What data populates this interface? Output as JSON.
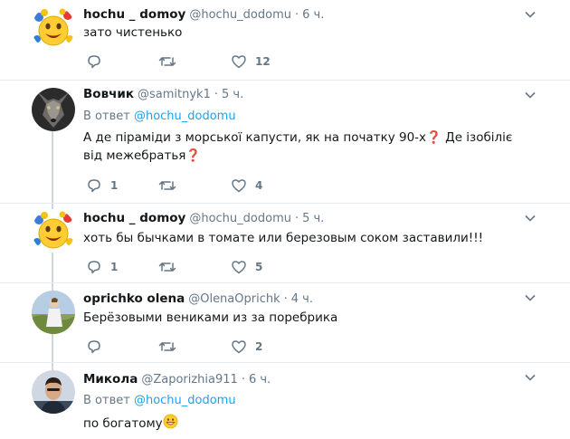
{
  "tweets": [
    {
      "name": "hochu _ domoy",
      "handle": "@hochu_dodomu",
      "time": "6 ч.",
      "reply_to": null,
      "text": "зато чистенько",
      "replies": "",
      "retweets": "",
      "likes": "12",
      "avatar": "emoji-flower-avatar"
    },
    {
      "name": "Вовчик",
      "handle": "@samitnyk1",
      "time": "5 ч.",
      "reply_to": {
        "prefix": "В ответ",
        "user": "@hochu_dodomu"
      },
      "text": "А де піраміди з морської капусти, як на початку 90-х❓ Де ізобіліє від межебратья❓",
      "replies": "1",
      "retweets": "",
      "likes": "4",
      "avatar": "wolf-avatar"
    },
    {
      "name": "hochu _ domoy",
      "handle": "@hochu_dodomu",
      "time": "5 ч.",
      "reply_to": null,
      "text": "хоть бы бычками  в томате или березовым соком заставили!!!",
      "replies": "1",
      "retweets": "",
      "likes": "5",
      "avatar": "emoji-flower-avatar"
    },
    {
      "name": "oprichko olena",
      "handle": "@OlenaOprichk",
      "time": "4 ч.",
      "reply_to": null,
      "text": "Берёзовыми вениками из за поребрика",
      "replies": "",
      "retweets": "",
      "likes": "2",
      "avatar": "person-outdoors-avatar"
    },
    {
      "name": "Микола",
      "handle": "@Zaporizhia911",
      "time": "6 ч.",
      "reply_to": {
        "prefix": "В ответ",
        "user": "@hochu_dodomu"
      },
      "text": "по богатому",
      "text_emoji": "grinning-face-emoji",
      "replies": "",
      "retweets": "",
      "likes": "",
      "avatar": "man-portrait-avatar"
    }
  ],
  "colors": {
    "link": "#1da1f2",
    "secondary": "#657786",
    "divider": "#e6ecf0",
    "thread_line": "#ccd6dd"
  }
}
